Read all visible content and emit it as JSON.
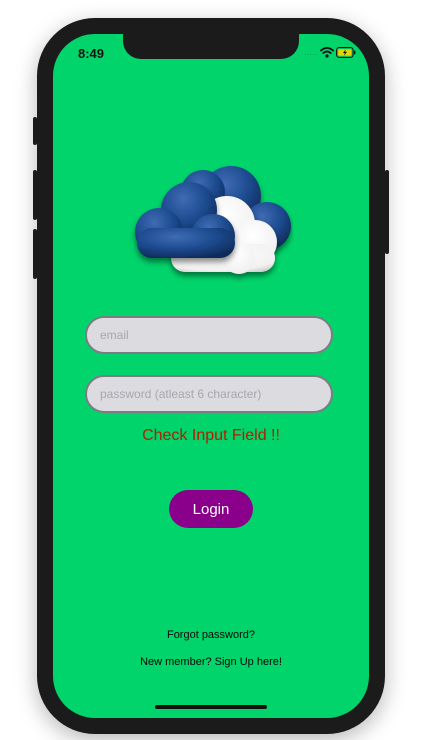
{
  "status_bar": {
    "time": "8:49",
    "signal_icon": "signal-dots-icon",
    "wifi_icon": "wifi-icon",
    "battery_icon": "battery-charging-icon"
  },
  "logo": {
    "icon": "cloud-icon"
  },
  "form": {
    "email": {
      "value": "",
      "placeholder": "email"
    },
    "password": {
      "value": "",
      "placeholder": "password (atleast 6 character)"
    },
    "error_message": "Check Input Field !!",
    "login_label": "Login"
  },
  "links": {
    "forgot_password": "Forgot password?",
    "sign_up": "New member? Sign Up here!"
  },
  "colors": {
    "background": "#00d46a",
    "button": "#8b008b",
    "error": "#b51c00",
    "field": "#dcdce0"
  }
}
